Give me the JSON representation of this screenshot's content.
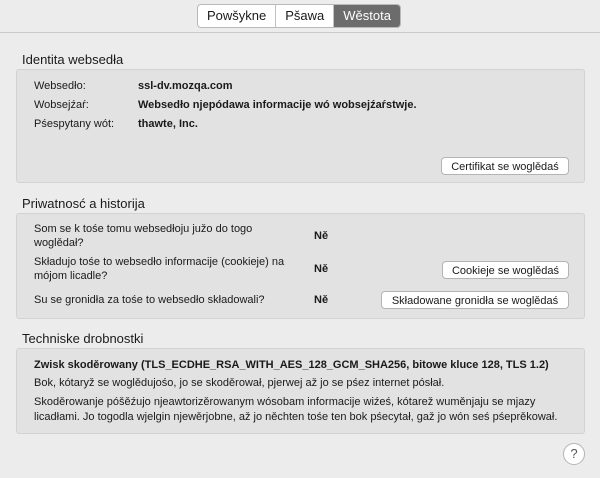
{
  "tabs": [
    {
      "label": "Powšykne",
      "active": false
    },
    {
      "label": "Pšawa",
      "active": false
    },
    {
      "label": "Wěstota",
      "active": true
    }
  ],
  "identity": {
    "title": "Identita websedła",
    "website_label": "Websedło:",
    "website_value": "ssl-dv.mozqa.com",
    "owner_label": "Wobsejźaŕ:",
    "owner_value": "Websedło njepódawa informacije wó wobsejźaŕstwje.",
    "verifier_label": "Pśespytany wót:",
    "verifier_value": "thawte, Inc.",
    "cert_button": "Certifikat se woglědaś"
  },
  "privacy": {
    "title": "Priwatnosć a historija",
    "q1": "Som se k tośe tomu websedłoju južo do togo woglědał?",
    "a1": "Ně",
    "q2": "Składujo tośe to websedło informacije (cookieje) na mójom licadle?",
    "a2": "Ně",
    "cookies_button": "Cookieje se woglědaś",
    "q3": "Su se gronidła za tośe to websedło składowali?",
    "a3": "Ně",
    "passwords_button": "Składowane gronidła se woglědaś"
  },
  "technical": {
    "title": "Techniske drobnostki",
    "summary": "Zwisk skoděrowany (TLS_ECDHE_RSA_WITH_AES_128_GCM_SHA256, bitowe kluce 128, TLS 1.2)",
    "line1": "Bok, kótaryž se woglědujośo, jo se skoděrował, pjerwej až jo se pśez internet pósłał.",
    "line2": "Skoděrowanje póšěźujo njeawtorizěrowanym wósobam informacije wiźeś, kótarež wuměnjaju se mjazy licadłami. Jo togodla wjelgin njewěrjobne, až jo něchten tośe ten bok pśecytał, gaž jo wón seś pśeprěkował."
  },
  "help": {
    "glyph": "?"
  }
}
